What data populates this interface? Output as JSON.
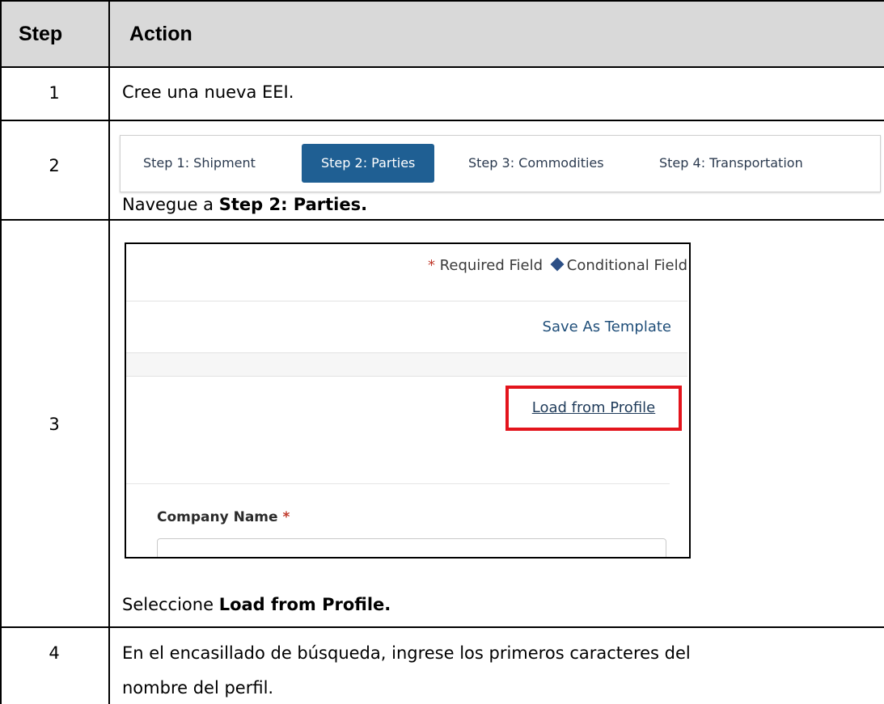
{
  "table": {
    "header": {
      "step": "Step",
      "action": "Action"
    },
    "rows": [
      {
        "step": "1",
        "text": "Cree una nueva EEI."
      },
      {
        "step": "2",
        "text_prefix": "Navegue a ",
        "text_bold": "Step 2: Parties."
      },
      {
        "step": "3",
        "text_prefix": "Seleccione ",
        "text_bold": "Load from Profile."
      },
      {
        "step": "4",
        "line1": "En el encasillado de búsqueda, ingrese los primeros caracteres del",
        "line2": "nombre del perfil."
      }
    ]
  },
  "tabs": [
    "Step 1: Shipment",
    "Step 2: Parties",
    "Step 3: Commodities",
    "Step 4: Transportation"
  ],
  "active_tab": "Step 2: Parties",
  "form": {
    "required_star": "*",
    "required_label": "Required Field",
    "conditional_label": "Conditional Field",
    "save_template": "Save As Template",
    "load_profile": "Load from Profile",
    "company_label": "Company Name",
    "company_star": "*"
  },
  "colors": {
    "header_bg": "#d9d9d9",
    "active_tab": "#1f5f93",
    "highlight": "#e3141c",
    "required": "#c0392b"
  }
}
